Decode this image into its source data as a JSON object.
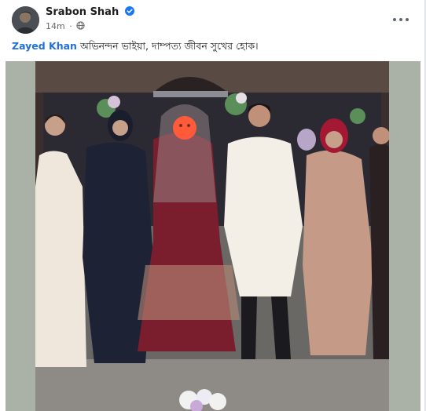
{
  "post": {
    "author": "Srabon Shah",
    "time": "14m",
    "separator": "·",
    "caption_mention": "Zayed Khan",
    "caption_text": " অভিনন্দন ভাইয়া, দাম্পত্য জীবন সুখের হোক।"
  },
  "icons": {
    "verified": "verified-badge-icon",
    "privacy": "globe-icon",
    "more": "more-options-icon"
  },
  "colors": {
    "link": "#216fdb",
    "verified": "#1877f2",
    "text": "#1c1e21",
    "secondary": "#65676b"
  }
}
